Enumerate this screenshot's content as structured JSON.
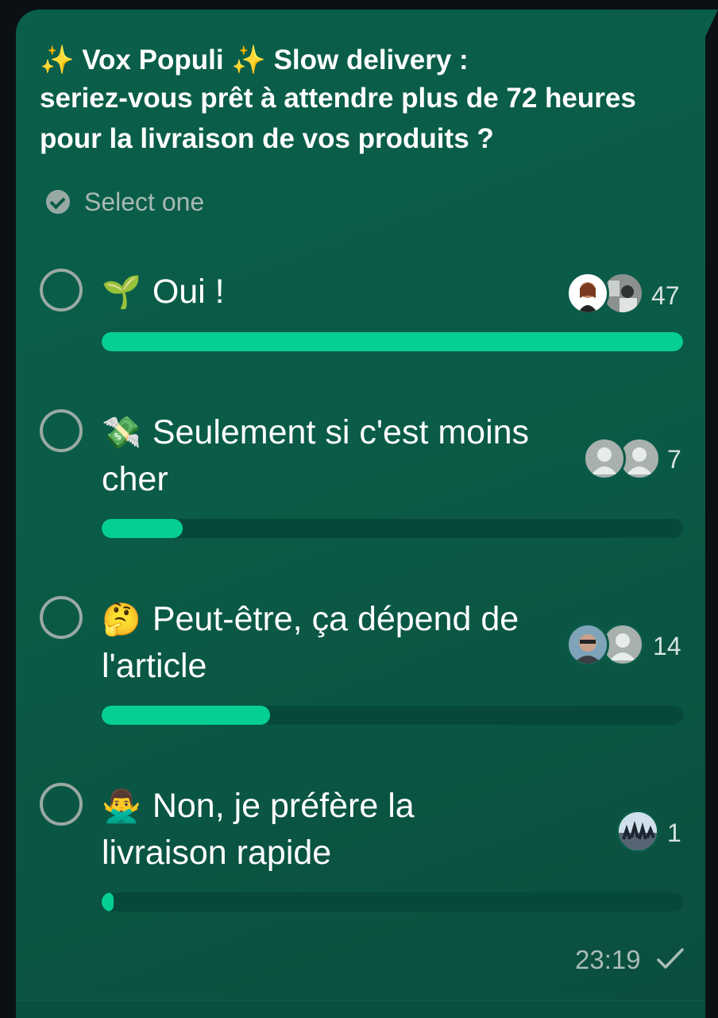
{
  "poll": {
    "question_line1": "✨ Vox Populi ✨ Slow delivery :",
    "question_line2": "seriez-vous prêt à attendre plus de 72 heures pour la livraison de vos produits ?",
    "select_hint": "Select one",
    "options": [
      {
        "emoji": "🌱",
        "label": "Oui !",
        "votes": "47",
        "share": 1.0
      },
      {
        "emoji": "💸",
        "label": "Seulement si c'est moins cher",
        "votes": "7",
        "share": 0.14
      },
      {
        "emoji": "🤔",
        "label": "Peut-être, ça dépend de l'article",
        "votes": "14",
        "share": 0.29
      },
      {
        "emoji": "🙅‍♂️",
        "label": "Non, je préfère la livraison rapide",
        "votes": "1",
        "share": 0.02
      }
    ],
    "timestamp": "23:19",
    "status_icon": "single-check-icon"
  },
  "colors": {
    "bubble": "#0a5b48",
    "bar_fill": "#06cf96",
    "bar_track": "#06493a",
    "text": "#ffffff",
    "muted": "#a9b8b2"
  }
}
